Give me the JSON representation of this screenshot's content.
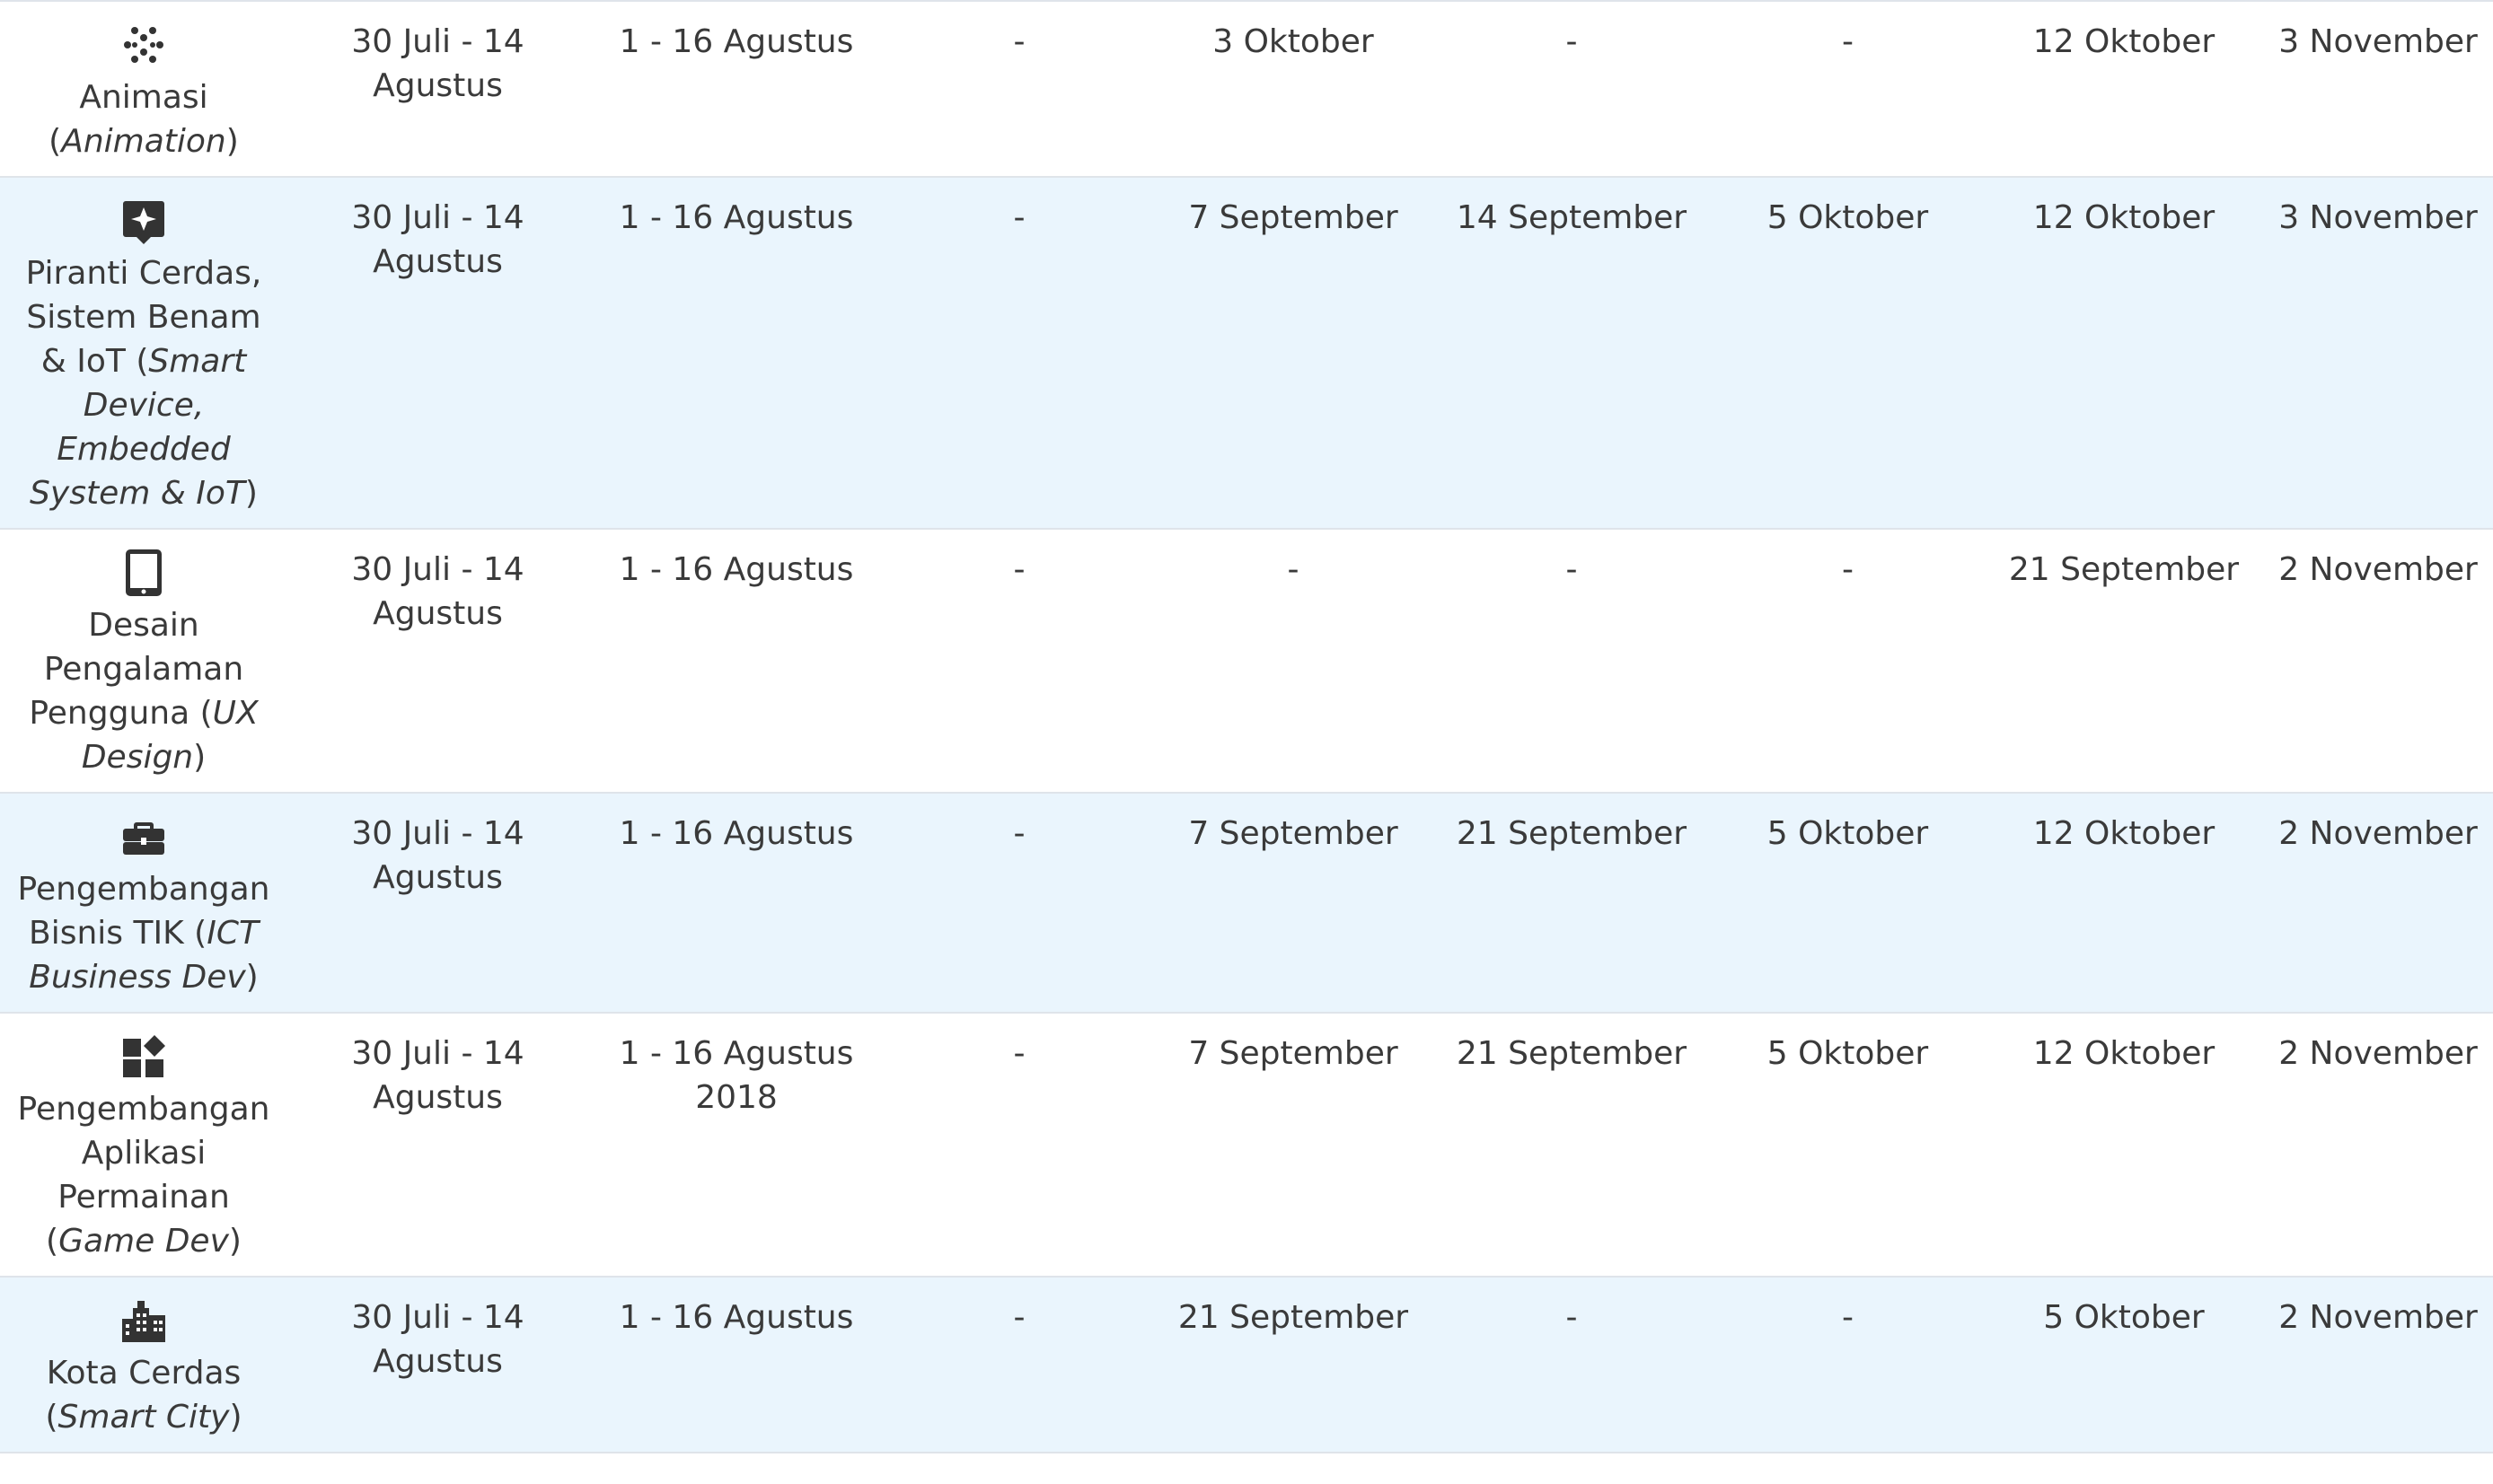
{
  "table": {
    "rows": [
      {
        "category": "Animasi",
        "category_en": "Animation",
        "icon": "animation-dots-icon",
        "cells": [
          "30 Juli - 14 Agustus",
          "1 - 16 Agustus",
          "-",
          "3 Oktober",
          "-",
          "-",
          "12 Oktober",
          "3 November"
        ]
      },
      {
        "category": "Piranti Cerdas, Sistem Benam & IoT",
        "category_en": "Smart Device, Embedded System & IoT",
        "icon": "sparkle-badge-icon",
        "cells": [
          "30 Juli - 14 Agustus",
          "1 - 16 Agustus",
          "-",
          "7 September",
          "14 September",
          "5 Oktober",
          "12 Oktober",
          "3 November"
        ]
      },
      {
        "category": "Desain Pengalaman Pengguna",
        "category_en": "UX Design",
        "icon": "tablet-icon",
        "cells": [
          "30 Juli - 14 Agustus",
          "1 - 16 Agustus",
          "-",
          "-",
          "-",
          "-",
          "21 September",
          "2 November"
        ]
      },
      {
        "category": "Pengembangan Bisnis TIK",
        "category_en": "ICT Business Dev",
        "icon": "briefcase-icon",
        "cells": [
          "30 Juli - 14 Agustus",
          "1 - 16 Agustus",
          "-",
          "7 September",
          "21 September",
          "5 Oktober",
          "12 Oktober",
          "2 November"
        ]
      },
      {
        "category": "Pengembangan Aplikasi Permainan",
        "category_en": "Game Dev",
        "icon": "widgets-icon",
        "cells": [
          "30 Juli - 14 Agustus",
          "1 - 16 Agustus 2018",
          "-",
          "7 September",
          "21 September",
          "5 Oktober",
          "12 Oktober",
          "2 November"
        ]
      },
      {
        "category": "Kota Cerdas",
        "category_en": "Smart City",
        "icon": "city-buildings-icon",
        "cells": [
          "30 Juli - 14 Agustus",
          "1 - 16 Agustus",
          "-",
          "21 September",
          "-",
          "-",
          "5 Oktober",
          "2 November"
        ]
      }
    ]
  },
  "colors": {
    "category_text": "#1a5fa6",
    "icon": "#333333",
    "row_alt_bg": "#eaf5fd",
    "divider": "#dfe4ea"
  }
}
